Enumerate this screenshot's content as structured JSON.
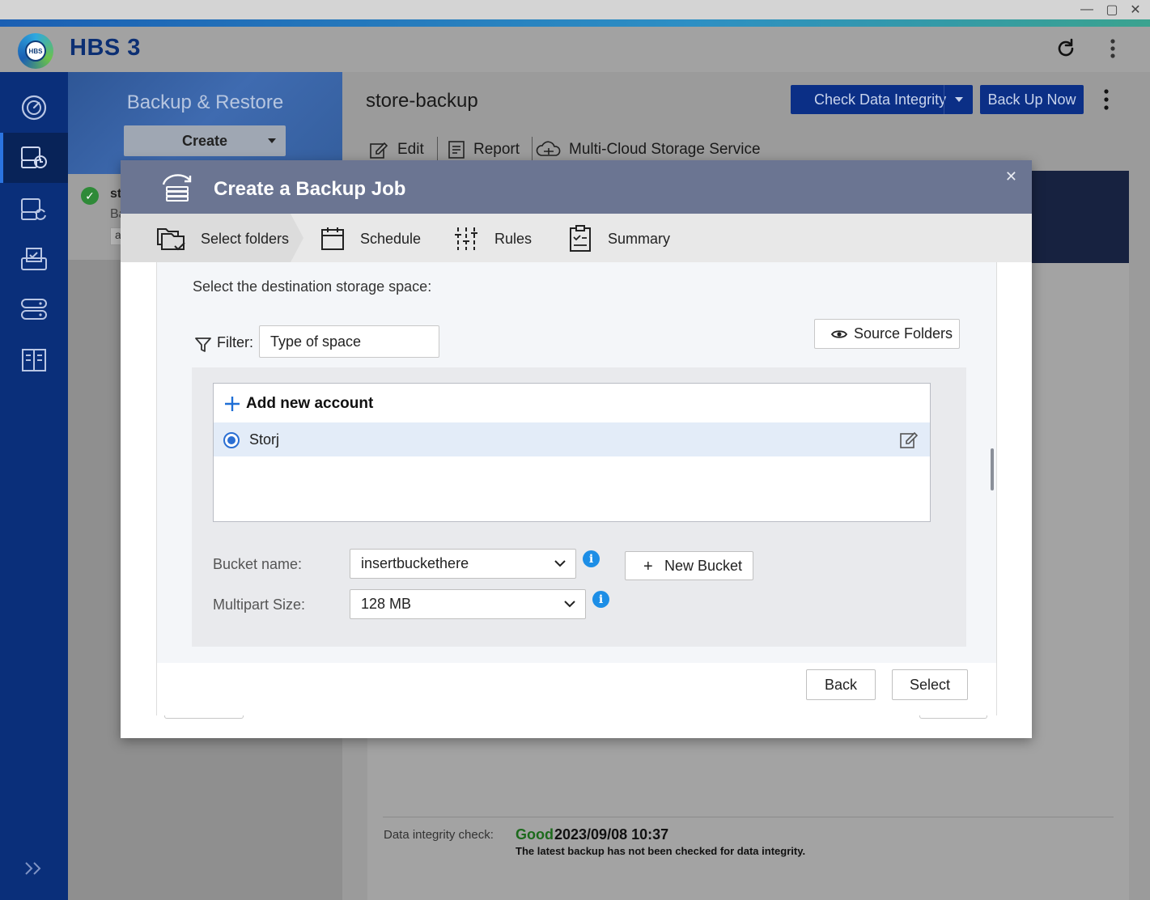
{
  "window": {
    "minimize_glyph": "—",
    "maximize_glyph": "▢",
    "close_glyph": "✕"
  },
  "app": {
    "logo_text": "HBS",
    "title": "HBS 3",
    "icons": [
      "refresh-icon",
      "more-vertical-icon"
    ]
  },
  "leftnav": {
    "items": [
      {
        "name": "overview",
        "icon": "dashboard-icon"
      },
      {
        "name": "backup-restore",
        "icon": "backup-restore-icon",
        "active": true
      },
      {
        "name": "sync",
        "icon": "sync-icon"
      },
      {
        "name": "services",
        "icon": "services-icon"
      },
      {
        "name": "storage-spaces",
        "icon": "storage-icon"
      },
      {
        "name": "logs",
        "icon": "logs-icon"
      }
    ],
    "expand_icon": "double-chevron-right-icon"
  },
  "panel": {
    "title": "Backup & Restore",
    "create_label": "Create",
    "job_item": {
      "name_partial": "st",
      "type_partial": "Ba",
      "tag_partial": "a"
    }
  },
  "main": {
    "job_title": "store-backup",
    "check_integrity_label": "Check Data Integrity",
    "backup_now_label": "Back Up Now",
    "toolbar": {
      "edit": "Edit",
      "report": "Report",
      "multicloud": "Multi-Cloud Storage Service"
    },
    "integrity": {
      "label": "Data integrity check:",
      "status": "Good",
      "date": "2023/09/08 10:37",
      "note": "The latest backup has not been checked for data integrity."
    }
  },
  "modal": {
    "title": "Create a Backup Job",
    "steps": [
      {
        "label": "Select folders",
        "icon": "folders-icon",
        "active": true
      },
      {
        "label": "Schedule",
        "icon": "calendar-icon"
      },
      {
        "label": "Rules",
        "icon": "sliders-icon"
      },
      {
        "label": "Summary",
        "icon": "clipboard-icon"
      }
    ],
    "destination_label": "Select the destination storage space:",
    "filter_label": "Filter:",
    "filter_value": "Type of space",
    "source_folders_label": "Source Folders",
    "add_account_label": "Add new account",
    "accounts": [
      {
        "name": "Storj",
        "selected": true
      }
    ],
    "bucket_label": "Bucket name:",
    "bucket_value": "insertbuckethere",
    "multipart_label": "Multipart Size:",
    "multipart_value": "128 MB",
    "new_bucket_label": "New Bucket",
    "back_label": "Back",
    "select_label": "Select",
    "info_glyph": "i"
  },
  "colors": {
    "brand_navy": "#0a2f7a",
    "primary_button": "#0b2f86",
    "modal_header": "#6b7592",
    "selected_row": "#e3ecf8",
    "radio_accent": "#2b6fd3",
    "info_blue": "#1d8ee6",
    "good_green": "#1c6a1c"
  }
}
